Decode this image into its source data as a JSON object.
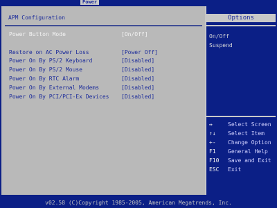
{
  "tabs": {
    "active": "Power"
  },
  "main": {
    "title": "APM Configuration",
    "rows": [
      {
        "label": "Power Button Mode",
        "value": "[On/Off]",
        "selected": true
      },
      {
        "label": "Restore on AC Power Loss",
        "value": "[Power Off]"
      },
      {
        "label": "Power On By PS/2 Keyboard",
        "value": "[Disabled]"
      },
      {
        "label": "Power On By PS/2 Mouse",
        "value": "[Disabled]"
      },
      {
        "label": "Power On By RTC Alarm",
        "value": "[Disabled]"
      },
      {
        "label": "Power On By External Modems",
        "value": "[Disabled]"
      },
      {
        "label": "Power On By PCI/PCI-Ex Devices",
        "value": "[Disabled]"
      }
    ]
  },
  "help": {
    "title": "Options",
    "options": [
      "On/Off",
      "Suspend"
    ],
    "keys": [
      {
        "key": "↔",
        "desc": "Select Screen",
        "icon": "left-right-arrows-icon"
      },
      {
        "key": "↑↓",
        "desc": "Select Item",
        "icon": "up-down-arrows-icon"
      },
      {
        "key": "+-",
        "desc": "Change Option",
        "icon": "plus-minus-icon"
      },
      {
        "key": "F1",
        "desc": "General Help"
      },
      {
        "key": "F10",
        "desc": "Save and Exit"
      },
      {
        "key": "ESC",
        "desc": "Exit"
      }
    ]
  },
  "footer": {
    "text": "v02.58 (C)Copyright 1985-2005, American Megatrends, Inc."
  },
  "colors": {
    "background": "#0b1f86",
    "panel": "#b9b9b9",
    "text_dark": "#1a2a9a",
    "text_light": "#f4f4f4"
  }
}
